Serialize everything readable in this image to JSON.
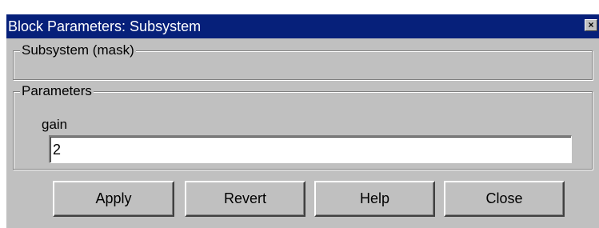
{
  "window": {
    "title": "Block Parameters: Subsystem",
    "close_glyph": "×",
    "close_icon": "close-icon",
    "titlebar_color": "#06207a",
    "background_color": "#c0c0c0"
  },
  "mask_group": {
    "legend": "Subsystem (mask)"
  },
  "parameters_group": {
    "legend": "Parameters",
    "fields": [
      {
        "label": "gain",
        "value": "2"
      }
    ]
  },
  "buttons": {
    "apply": "Apply",
    "revert": "Revert",
    "help": "Help",
    "close": "Close"
  }
}
